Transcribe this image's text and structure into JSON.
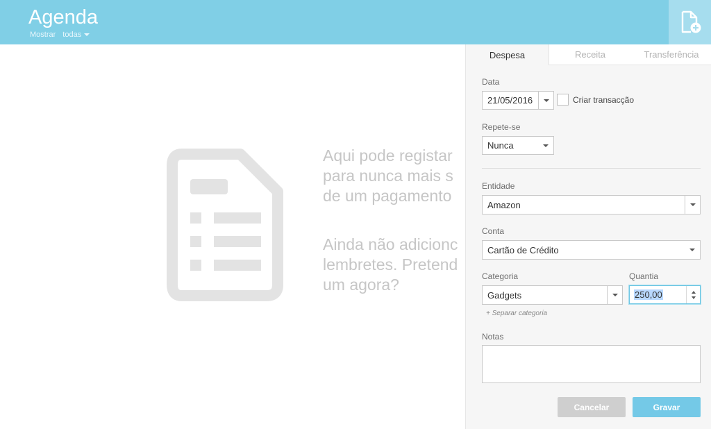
{
  "header": {
    "title": "Agenda",
    "show_label": "Mostrar",
    "show_value": "todas",
    "new_icon": "new-document-icon"
  },
  "empty_state": {
    "icon": "document-list-icon",
    "line1": "Aqui pode registar",
    "line2": "para nunca mais s",
    "line3": "de um pagamento",
    "line4": "Ainda não adicionc",
    "line5": "lembretes. Pretend",
    "line6": "um agora?"
  },
  "panel": {
    "tabs": [
      {
        "label": "Despesa"
      },
      {
        "label": "Receita"
      },
      {
        "label": "Transferência"
      }
    ],
    "date_label": "Data",
    "date_value": "21/05/2016",
    "create_transaction_label": "Criar transacção",
    "repeat_label": "Repete-se",
    "repeat_value": "Nunca",
    "entity_label": "Entidade",
    "entity_value": "Amazon",
    "account_label": "Conta",
    "account_value": "Cartão de Crédito",
    "category_label": "Categoria",
    "category_value": "Gadgets",
    "amount_label": "Quantia",
    "amount_value": "250,00",
    "split_category_link": "+ Separar categoria",
    "notes_label": "Notas",
    "cancel_label": "Cancelar",
    "save_label": "Gravar"
  },
  "colors": {
    "header_bg": "#80cfe6",
    "accent": "#74c9e7",
    "panel_bg": "#f6f6f6"
  }
}
